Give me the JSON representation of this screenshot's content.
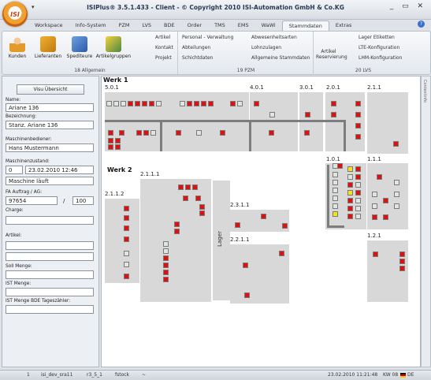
{
  "app": {
    "title": "ISIPlus® 3.5.1.433 - Client - © Copyright 2010 ISI-Automation GmbH & Co.KG",
    "logo_text": "ISI",
    "quick_access": "▾",
    "window_controls": "_ ▭ ✕"
  },
  "tabs": [
    "Workspace",
    "Info-System",
    "PZM",
    "LVS",
    "BDE",
    "Order",
    "TMS",
    "EMS",
    "WaWi",
    "Stammdaten",
    "Extras"
  ],
  "ribbon": {
    "group1": {
      "label": "18 Allgemein",
      "buttons": [
        "Kunden",
        "Lieferanten",
        "Spediteure",
        "Artikelgruppen"
      ],
      "small": [
        "Artikel",
        "Kontakt",
        "Projekt"
      ]
    },
    "group2": {
      "label": "19 PZM",
      "col1": [
        "Personal - Verwaltung",
        "Abteilungen",
        "Schichtdaten"
      ],
      "col2": [
        "Abwesenheitsarten",
        "Lohnzulagen",
        "Allgemeine Stammdaten"
      ]
    },
    "group3": {
      "label": "20 LVS",
      "left": "Artikel Reservierung",
      "col": [
        "Lager Etiketten",
        "LTE-Konfiguration",
        "LHM-Konfiguration"
      ]
    }
  },
  "left_panel": {
    "button": "Visu Übersicht",
    "fields": [
      {
        "label": "Name:",
        "value": "Ariane 136"
      },
      {
        "label": "Bezeichnung:",
        "value": "Stanz. Ariane 136"
      },
      {
        "label": "Maschinenbediener:",
        "value": "Hans Mustermann"
      },
      {
        "label": "Maschinenzustand:",
        "value": "Maschine läuft"
      },
      {
        "label": "FA Auftrag / AG:",
        "value": ""
      },
      {
        "label": "Charge:",
        "value": ""
      },
      {
        "label": "Artikel:",
        "value": ""
      },
      {
        "label": "Soll Menge:",
        "value": ""
      },
      {
        "label": "IST Menge:",
        "value": ""
      },
      {
        "label": "IST Menge BDE Tageszähler:",
        "value": ""
      }
    ],
    "state_num": "0",
    "state_date": "23.02.2010 12:46",
    "fa_order": "97654",
    "fa_sep": "/",
    "fa_ag": "100"
  },
  "canvas": {
    "werk1": "Werk 1",
    "werk2": "Werk 2",
    "lager": "Lager",
    "zones": [
      "5.0.1",
      "4.0.1",
      "3.0.1",
      "2.0.1",
      "2.1.1",
      "1.0.1",
      "1.1.1",
      "2.1.1.1",
      "2.1.1.2",
      "2.3.1.1",
      "2.2.1.1",
      "1.2.1"
    ],
    "status_colors": {
      "running": "#e01010",
      "idle": "#dfe6df",
      "warning": "#f6e21a"
    }
  },
  "side_scroll_label": "Contextinfo",
  "statusbar": {
    "items": [
      "1",
      "isi_dev_sra11",
      "r3_5_1",
      "fstock",
      "~"
    ],
    "datetime": "23.02.2010 11:21:48",
    "week": "KW 08",
    "lang": "DE"
  }
}
